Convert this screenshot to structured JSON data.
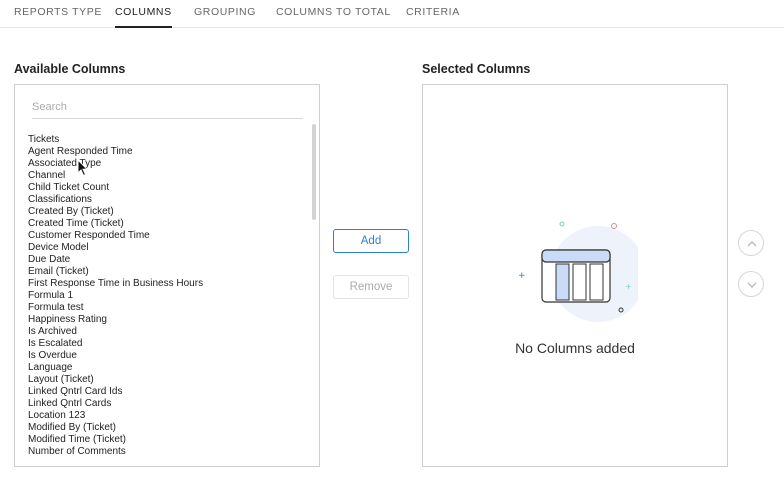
{
  "tabs": [
    {
      "label": "REPORTS TYPE"
    },
    {
      "label": "COLUMNS",
      "active": true
    },
    {
      "label": "GROUPING"
    },
    {
      "label": "COLUMNS TO TOTAL"
    },
    {
      "label": "CRITERIA"
    }
  ],
  "available": {
    "title": "Available Columns",
    "search_placeholder": "Search",
    "search_value": "",
    "columns": [
      "Tickets",
      "Agent Responded Time",
      "Associated Type",
      "Channel",
      "Child Ticket Count",
      "Classifications",
      "Created By (Ticket)",
      "Created Time (Ticket)",
      "Customer Responded Time",
      "Device Model",
      "Due Date",
      "Email (Ticket)",
      "First Response Time in Business Hours",
      "Formula 1",
      "Formula test",
      "Happiness Rating",
      "Is Archived",
      "Is Escalated",
      "Is Overdue",
      "Language",
      "Layout (Ticket)",
      "Linked Qntrl Card Ids",
      "Linked Qntrl Cards",
      "Location 123",
      "Modified By (Ticket)",
      "Modified Time (Ticket)",
      "Number of Comments"
    ]
  },
  "actions": {
    "add_label": "Add",
    "remove_label": "Remove"
  },
  "selected": {
    "title": "Selected Columns",
    "empty_text": "No Columns added"
  },
  "icons": {
    "move_up": "chevron-up-icon",
    "move_down": "chevron-down-icon",
    "empty_state": "table-columns-illustration",
    "cursor": "mouse-pointer-icon"
  },
  "colors": {
    "accent": "#2f80d1",
    "illustration_bg": "#eef3fb",
    "illustration_fill": "#c9dbf7"
  }
}
